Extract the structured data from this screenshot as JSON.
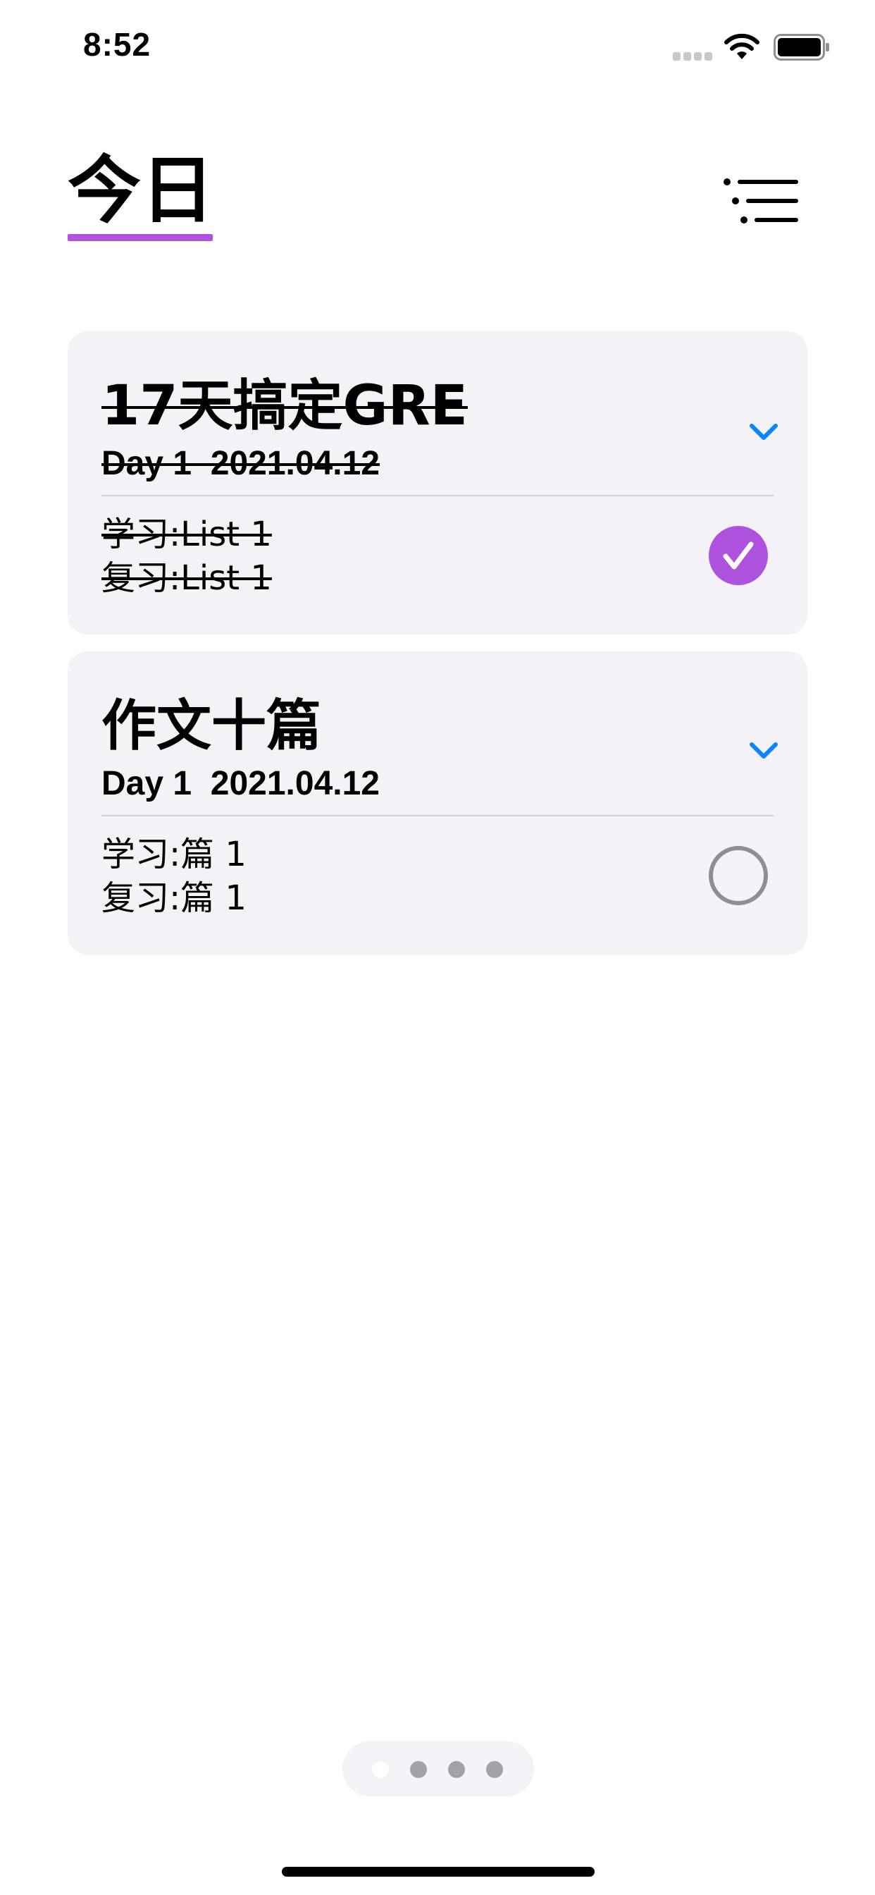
{
  "status_bar": {
    "time": "8:52"
  },
  "header": {
    "title": "今日",
    "accent_color": "#af52de",
    "menu_icon": "list-menu-icon"
  },
  "cards": [
    {
      "title": "17天搞定GRE",
      "day_line": "Day 1  2021.04.12",
      "study": "学习:List 1",
      "review": "复习:List 1",
      "completed": true,
      "expand_icon": "chevron-down-icon"
    },
    {
      "title": "作文十篇",
      "day_line": "Day 1  2021.04.12",
      "study": "学习:篇 1",
      "review": "复习:篇 1",
      "completed": false,
      "expand_icon": "chevron-down-icon"
    }
  ],
  "page_indicator": {
    "total": 4,
    "current": 1
  },
  "colors": {
    "accent": "#af52de",
    "chevron": "#0a84ff",
    "card_background": "#f2f2f7",
    "unchecked_ring": "#8e8e93"
  }
}
